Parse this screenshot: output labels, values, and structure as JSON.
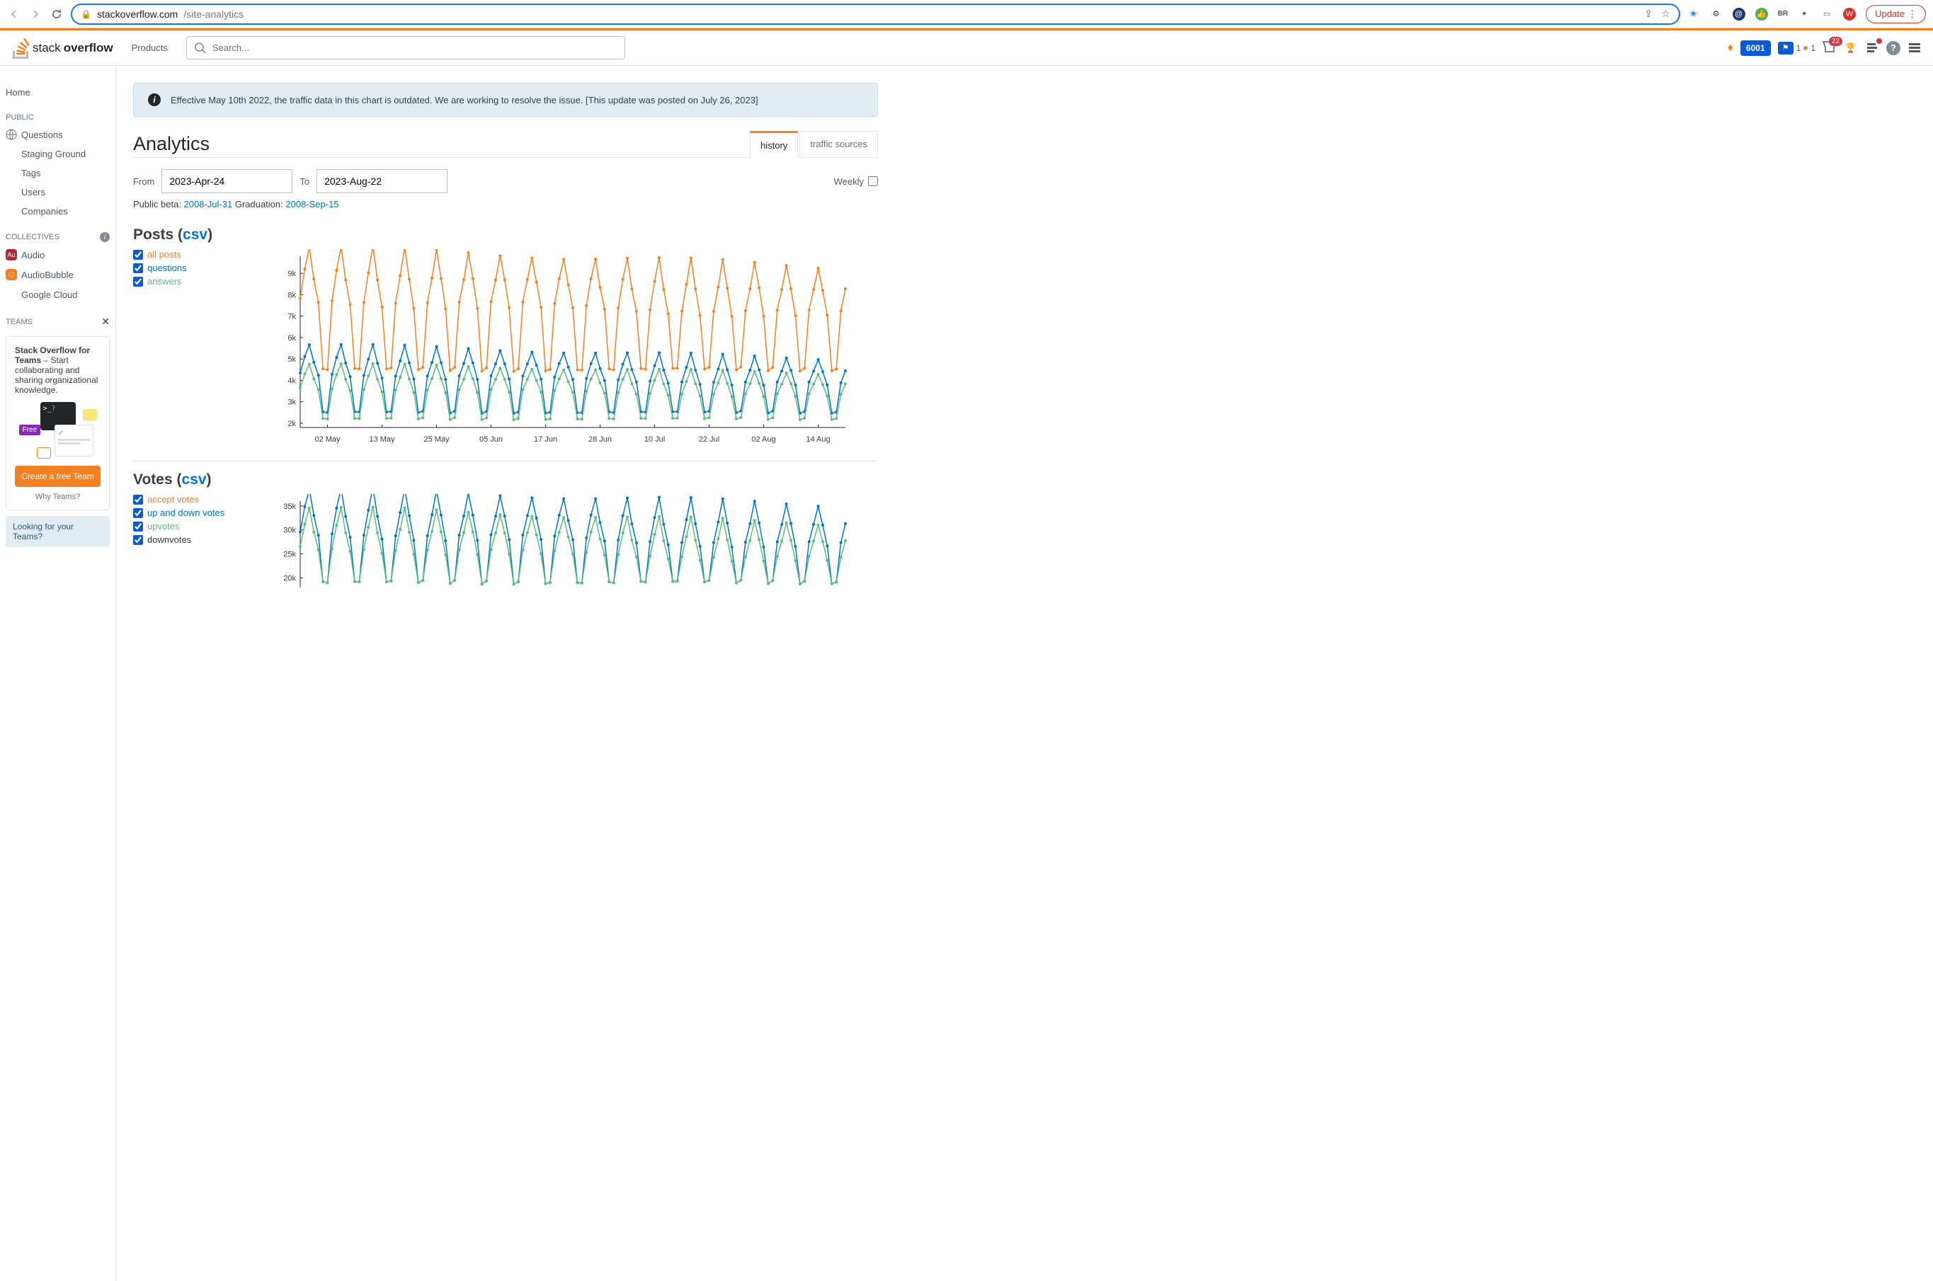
{
  "browser": {
    "url_host": "stackoverflow.com",
    "url_path": "/site-analytics",
    "update_label": "Update",
    "profile_initials": "BR",
    "avatar_initial": "W"
  },
  "topbar": {
    "products_label": "Products",
    "search_placeholder": "Search...",
    "reputation": "6001",
    "flag_count": "1",
    "bronze_count": "1",
    "inbox_count": "22",
    "logo_text_prefix": "stack",
    "logo_text_bold": "overflow"
  },
  "sidebar": {
    "home": "Home",
    "public_header": "PUBLIC",
    "questions": "Questions",
    "staging": "Staging Ground",
    "tags": "Tags",
    "users": "Users",
    "companies": "Companies",
    "collectives_header": "COLLECTIVES",
    "collectives": [
      {
        "name": "Audio",
        "initials": "Au",
        "color": "#b02a37"
      },
      {
        "name": "AudioBubble",
        "initials": "🗨",
        "color": "#f48024"
      },
      {
        "name": "Google Cloud",
        "initials": "☁",
        "color": "#fff"
      }
    ],
    "teams_header": "TEAMS",
    "teams_card_title": "Stack Overflow for Teams",
    "teams_card_body": " – Start collaborating and sharing organizational knowledge.",
    "free_tag": "Free",
    "teams_btn": "Create a free Team",
    "teams_why": "Why Teams?",
    "looking": "Looking for your Teams?"
  },
  "notice": {
    "text": "Effective May 10th 2022, the traffic data in this chart is outdated. We are working to resolve the issue. [This update was posted on July 26, 2023]"
  },
  "page": {
    "title": "Analytics",
    "tabs": [
      {
        "label": "history",
        "active": true
      },
      {
        "label": "traffic sources",
        "active": false
      }
    ],
    "from_label": "From",
    "to_label": "To",
    "from_value": "2023-Apr-24",
    "to_value": "2023-Aug-22",
    "weekly_label": "Weekly",
    "beta_label": "Public beta: ",
    "beta_date": "2008-Jul-31",
    "grad_label": " Graduation: ",
    "grad_date": "2008-Sep-15"
  },
  "posts": {
    "title_prefix": "Posts (",
    "csv": "csv",
    "title_suffix": ")",
    "legend": [
      {
        "label": "all posts",
        "class": "orange"
      },
      {
        "label": "questions",
        "class": "blue"
      },
      {
        "label": "answers",
        "class": "green"
      }
    ]
  },
  "votes": {
    "title_prefix": "Votes (",
    "csv": "csv",
    "title_suffix": ")",
    "legend": [
      {
        "label": "accept votes",
        "class": "orange"
      },
      {
        "label": "up and down votes",
        "class": "blue"
      },
      {
        "label": "upvotes",
        "class": "green"
      },
      {
        "label": "downvotes",
        "class": "dark"
      }
    ]
  },
  "chart_data": [
    {
      "type": "line",
      "title": "Posts",
      "x_ticks": [
        "02 May",
        "13 May",
        "25 May",
        "05 Jun",
        "17 Jun",
        "28 Jun",
        "10 Jul",
        "22 Jul",
        "02 Aug",
        "14 Aug"
      ],
      "y_ticks": [
        2000,
        3000,
        4000,
        5000,
        6000,
        7000,
        8000,
        9000
      ],
      "y_tick_labels": [
        "2k",
        "3k",
        "4k",
        "5k",
        "6k",
        "7k",
        "8k",
        "9k"
      ],
      "ylim": [
        1800,
        9800
      ],
      "n_points": 121,
      "series": [
        {
          "name": "all posts",
          "color": "#f48024",
          "pattern": {
            "weekday": 9000,
            "weekend": 4500,
            "weekday_later": 8200,
            "decay": 0.9
          }
        },
        {
          "name": "questions",
          "color": "#0074cc",
          "pattern": {
            "weekday": 5000,
            "weekend": 2500,
            "weekday_later": 4400,
            "decay": 0.97
          }
        },
        {
          "name": "answers",
          "color": "#5eba7d",
          "pattern": {
            "weekday": 4200,
            "weekend": 2200,
            "weekday_later": 3800,
            "decay": 0.96
          }
        }
      ]
    },
    {
      "type": "line",
      "title": "Votes",
      "y_ticks": [
        20000,
        25000,
        30000,
        35000
      ],
      "y_tick_labels": [
        "20k",
        "25k",
        "30k",
        "35k"
      ],
      "ylim": [
        18000,
        36000
      ],
      "n_points": 121,
      "series": [
        {
          "name": "up and down votes",
          "color": "#0074cc",
          "pattern": {
            "weekday": 34000,
            "weekend": 19000,
            "weekday_later": 31000
          }
        },
        {
          "name": "upvotes",
          "color": "#5eba7d",
          "pattern": {
            "weekday": 30500,
            "weekend": 19000,
            "weekday_later": 27500
          }
        }
      ]
    }
  ]
}
